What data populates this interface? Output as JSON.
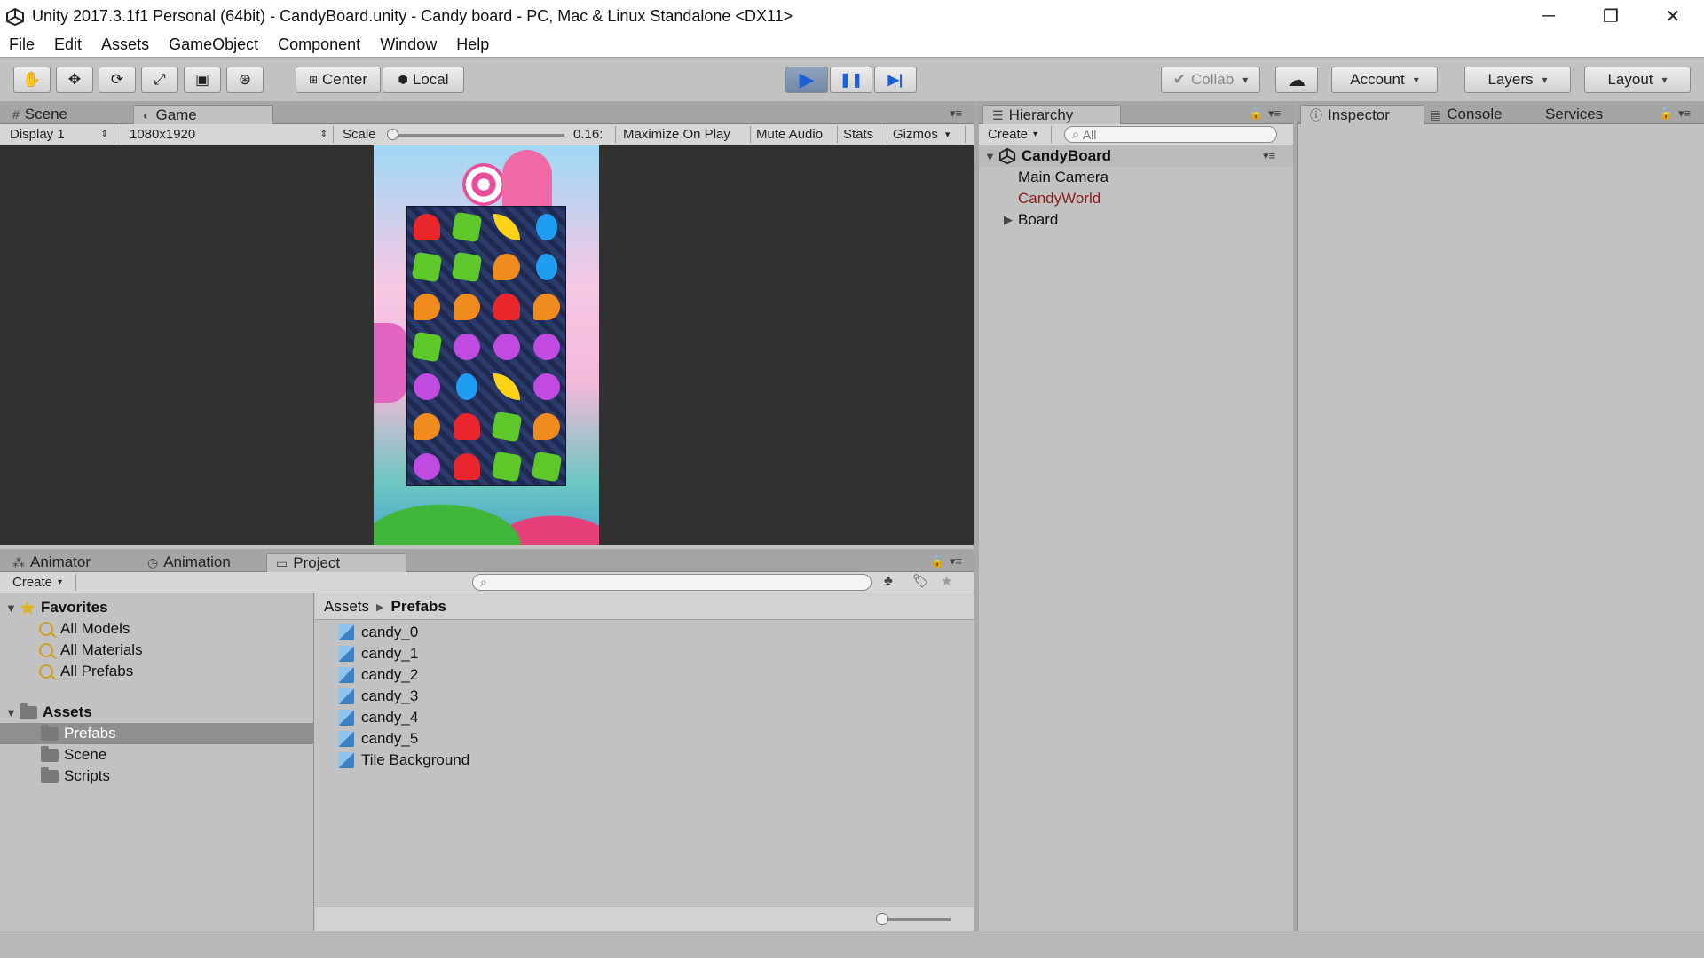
{
  "window": {
    "title": "Unity 2017.3.1f1 Personal (64bit) - CandyBoard.unity - Candy board - PC, Mac & Linux Standalone <DX11>",
    "controls": {
      "minimize": "─",
      "restore": "❐",
      "close": "✕"
    }
  },
  "menu": [
    "File",
    "Edit",
    "Assets",
    "GameObject",
    "Component",
    "Window",
    "Help"
  ],
  "toolbar": {
    "tools": [
      "hand-tool-icon",
      "move-tool-icon",
      "rotate-tool-icon",
      "scale-tool-icon",
      "rect-tool-icon",
      "transform-tool-icon"
    ],
    "pivot": "Center",
    "space": "Local",
    "play": "▶",
    "pause": "❚❚",
    "step": "▶|",
    "collab": "Collab",
    "account": "Account",
    "layers": "Layers",
    "layout": "Layout"
  },
  "game_view": {
    "tabs": {
      "scene": "Scene",
      "game": "Game"
    },
    "display": "Display 1",
    "resolution": "1080x1920",
    "scale_label": "Scale",
    "scale_value": "0.16:",
    "buttons": {
      "maximize": "Maximize On Play",
      "mute": "Mute Audio",
      "stats": "Stats",
      "gizmos": "Gizmos"
    },
    "board": [
      [
        "red",
        "green",
        "yellow",
        "blue"
      ],
      [
        "green",
        "green",
        "orange",
        "blue"
      ],
      [
        "orange",
        "orange",
        "red",
        "orange"
      ],
      [
        "green",
        "purple",
        "purple",
        "purple"
      ],
      [
        "purple",
        "blue",
        "yellow",
        "purple"
      ],
      [
        "orange",
        "red",
        "green",
        "orange"
      ],
      [
        "purple",
        "red",
        "green",
        "green"
      ]
    ],
    "colors": {
      "red": "#e8262b",
      "green": "#5ec82b",
      "yellow": "#ffd21a",
      "blue": "#1f9df0",
      "orange": "#f08b1d",
      "purple": "#c14be0"
    }
  },
  "hierarchy": {
    "tab": "Hierarchy",
    "create": "Create",
    "search_placeholder": "All",
    "scene_name": "CandyBoard",
    "items": [
      "Main Camera",
      "CandyWorld",
      "Board"
    ]
  },
  "inspector": {
    "tabs": [
      "Inspector",
      "Console",
      "Services"
    ]
  },
  "bottom": {
    "tabs": [
      "Animator",
      "Animation",
      "Project"
    ],
    "create": "Create",
    "favorites_label": "Favorites",
    "favorites": [
      "All Models",
      "All Materials",
      "All Prefabs"
    ],
    "assets_label": "Assets",
    "asset_folders": [
      "Prefabs",
      "Scene",
      "Scripts"
    ],
    "breadcrumb": {
      "root": "Assets",
      "current": "Prefabs"
    },
    "files": [
      "candy_0",
      "candy_1",
      "candy_2",
      "candy_3",
      "candy_4",
      "candy_5",
      "Tile Background"
    ]
  }
}
